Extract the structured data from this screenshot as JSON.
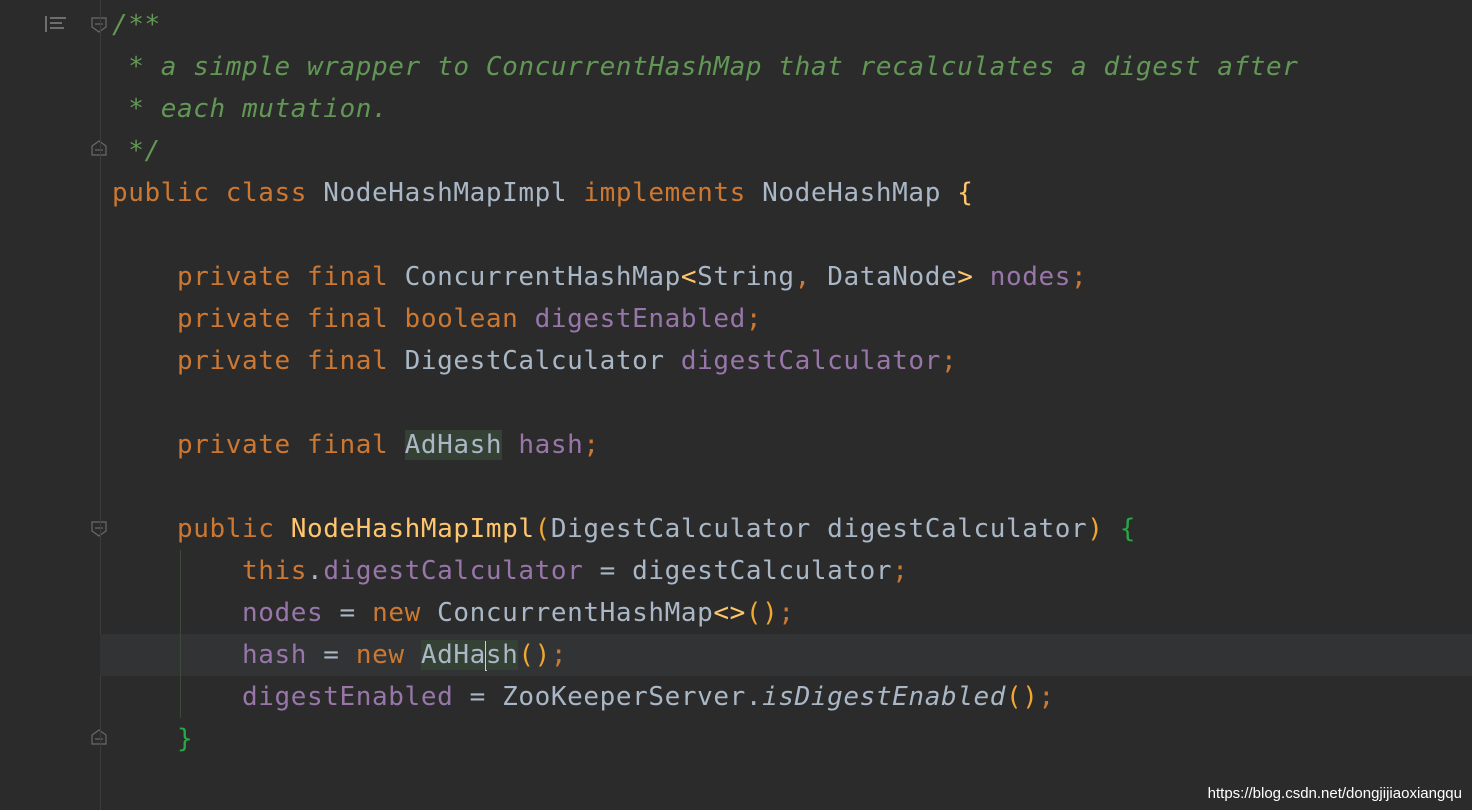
{
  "lines": [
    {
      "parts": [
        {
          "t": "/**",
          "c": "cmt"
        }
      ]
    },
    {
      "parts": [
        {
          "t": " * a simple wrapper to ConcurrentHashMap that recalculates a digest after",
          "c": "cmt"
        }
      ]
    },
    {
      "parts": [
        {
          "t": " * each mutation.",
          "c": "cmt"
        }
      ]
    },
    {
      "parts": [
        {
          "t": " */",
          "c": "cmt"
        }
      ]
    },
    {
      "parts": [
        {
          "t": "public class ",
          "c": "kw"
        },
        {
          "t": "NodeHashMapImpl ",
          "c": "cls"
        },
        {
          "t": "implements ",
          "c": "kw"
        },
        {
          "t": "NodeHashMap ",
          "c": "cls"
        },
        {
          "t": "{",
          "c": "brace"
        }
      ]
    },
    {
      "parts": []
    },
    {
      "parts": [
        {
          "t": "    private final ",
          "c": "kw"
        },
        {
          "t": "ConcurrentHashMap",
          "c": "cls"
        },
        {
          "t": "<",
          "c": "brace"
        },
        {
          "t": "String",
          "c": "cls"
        },
        {
          "t": ", ",
          "c": "punc"
        },
        {
          "t": "DataNode",
          "c": "cls"
        },
        {
          "t": "> ",
          "c": "brace"
        },
        {
          "t": "nodes",
          "c": "fld"
        },
        {
          "t": ";",
          "c": "punc"
        }
      ]
    },
    {
      "parts": [
        {
          "t": "    private final boolean ",
          "c": "kw"
        },
        {
          "t": "digestEnabled",
          "c": "fld"
        },
        {
          "t": ";",
          "c": "punc"
        }
      ]
    },
    {
      "parts": [
        {
          "t": "    private final ",
          "c": "kw"
        },
        {
          "t": "DigestCalculator ",
          "c": "cls"
        },
        {
          "t": "digestCalculator",
          "c": "fld"
        },
        {
          "t": ";",
          "c": "punc"
        }
      ]
    },
    {
      "parts": []
    },
    {
      "parts": [
        {
          "t": "    private final ",
          "c": "kw"
        },
        {
          "t": "AdHash",
          "c": "cls hl"
        },
        {
          "t": " ",
          "c": "plain"
        },
        {
          "t": "hash",
          "c": "fld"
        },
        {
          "t": ";",
          "c": "punc"
        }
      ]
    },
    {
      "parts": []
    },
    {
      "parts": [
        {
          "t": "    public ",
          "c": "kw"
        },
        {
          "t": "NodeHashMapImpl",
          "c": "fn"
        },
        {
          "t": "(",
          "c": "paren"
        },
        {
          "t": "DigestCalculator digestCalculator",
          "c": "cls"
        },
        {
          "t": ") ",
          "c": "paren"
        },
        {
          "t": "{",
          "c": "green"
        }
      ]
    },
    {
      "parts": [
        {
          "t": "        this",
          "c": "kw"
        },
        {
          "t": ".",
          "c": "plain"
        },
        {
          "t": "digestCalculator",
          "c": "fld"
        },
        {
          "t": " = digestCalculator",
          "c": "plain"
        },
        {
          "t": ";",
          "c": "punc"
        }
      ]
    },
    {
      "parts": [
        {
          "t": "        nodes",
          "c": "fld"
        },
        {
          "t": " = ",
          "c": "plain"
        },
        {
          "t": "new ",
          "c": "kw"
        },
        {
          "t": "ConcurrentHashMap",
          "c": "cls"
        },
        {
          "t": "<>",
          "c": "brace"
        },
        {
          "t": "()",
          "c": "paren"
        },
        {
          "t": ";",
          "c": "punc"
        }
      ]
    },
    {
      "parts": [
        {
          "t": "        hash",
          "c": "fld"
        },
        {
          "t": " = ",
          "c": "plain"
        },
        {
          "t": "new ",
          "c": "kw"
        },
        {
          "t": "AdHa",
          "c": "cls hl"
        },
        {
          "t": "|caret|",
          "c": "caret"
        },
        {
          "t": "sh",
          "c": "cls hl"
        },
        {
          "t": "()",
          "c": "paren"
        },
        {
          "t": ";",
          "c": "punc"
        }
      ]
    },
    {
      "parts": [
        {
          "t": "        digestEnabled",
          "c": "fld"
        },
        {
          "t": " = ZooKeeperServer.",
          "c": "plain"
        },
        {
          "t": "isDigestEnabled",
          "c": "ital"
        },
        {
          "t": "()",
          "c": "paren"
        },
        {
          "t": ";",
          "c": "punc"
        }
      ]
    },
    {
      "parts": [
        {
          "t": "    }",
          "c": "green"
        }
      ]
    }
  ],
  "watermark": "https://blog.csdn.net/dongjijiaoxiangqu"
}
